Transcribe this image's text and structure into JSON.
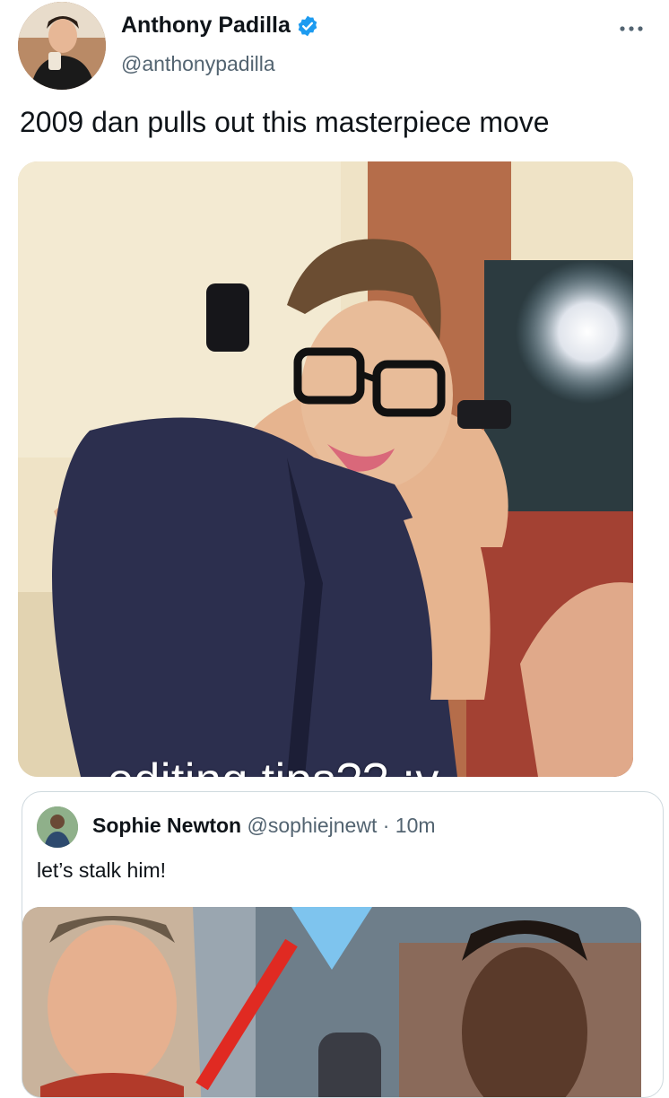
{
  "tweet": {
    "display_name": "Anthony Padilla",
    "handle": "@anthonypadilla",
    "text": "2009 dan pulls out this masterpiece move",
    "image_caption": "editing tips?? :v",
    "verified_color": "#1d9bf0"
  },
  "quoted_tweet": {
    "display_name": "Sophie Newton",
    "handle": "@sophiejnewt",
    "separator": "·",
    "time": "10m",
    "text": "let’s stalk him!"
  },
  "icons": [
    "verified-badge-icon",
    "more-options-icon"
  ]
}
